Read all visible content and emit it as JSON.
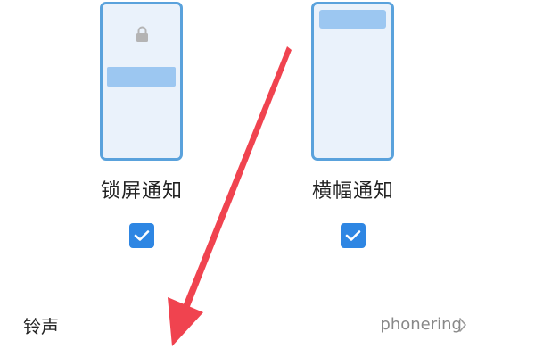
{
  "options": [
    {
      "label": "锁屏通知",
      "checked": true,
      "preview_icon": "lock-screen-preview-icon"
    },
    {
      "label": "横幅通知",
      "checked": true,
      "preview_icon": "banner-preview-icon"
    }
  ],
  "ringtone": {
    "label": "铃声",
    "value": "phonering",
    "chevron": "chevron-right-icon"
  },
  "colors": {
    "accent": "#2e86e3",
    "preview_border": "#5aa2dc",
    "preview_fill": "#eaf2fb",
    "notification_bar": "#9cc7f1",
    "annotation_arrow": "#f0434f"
  }
}
